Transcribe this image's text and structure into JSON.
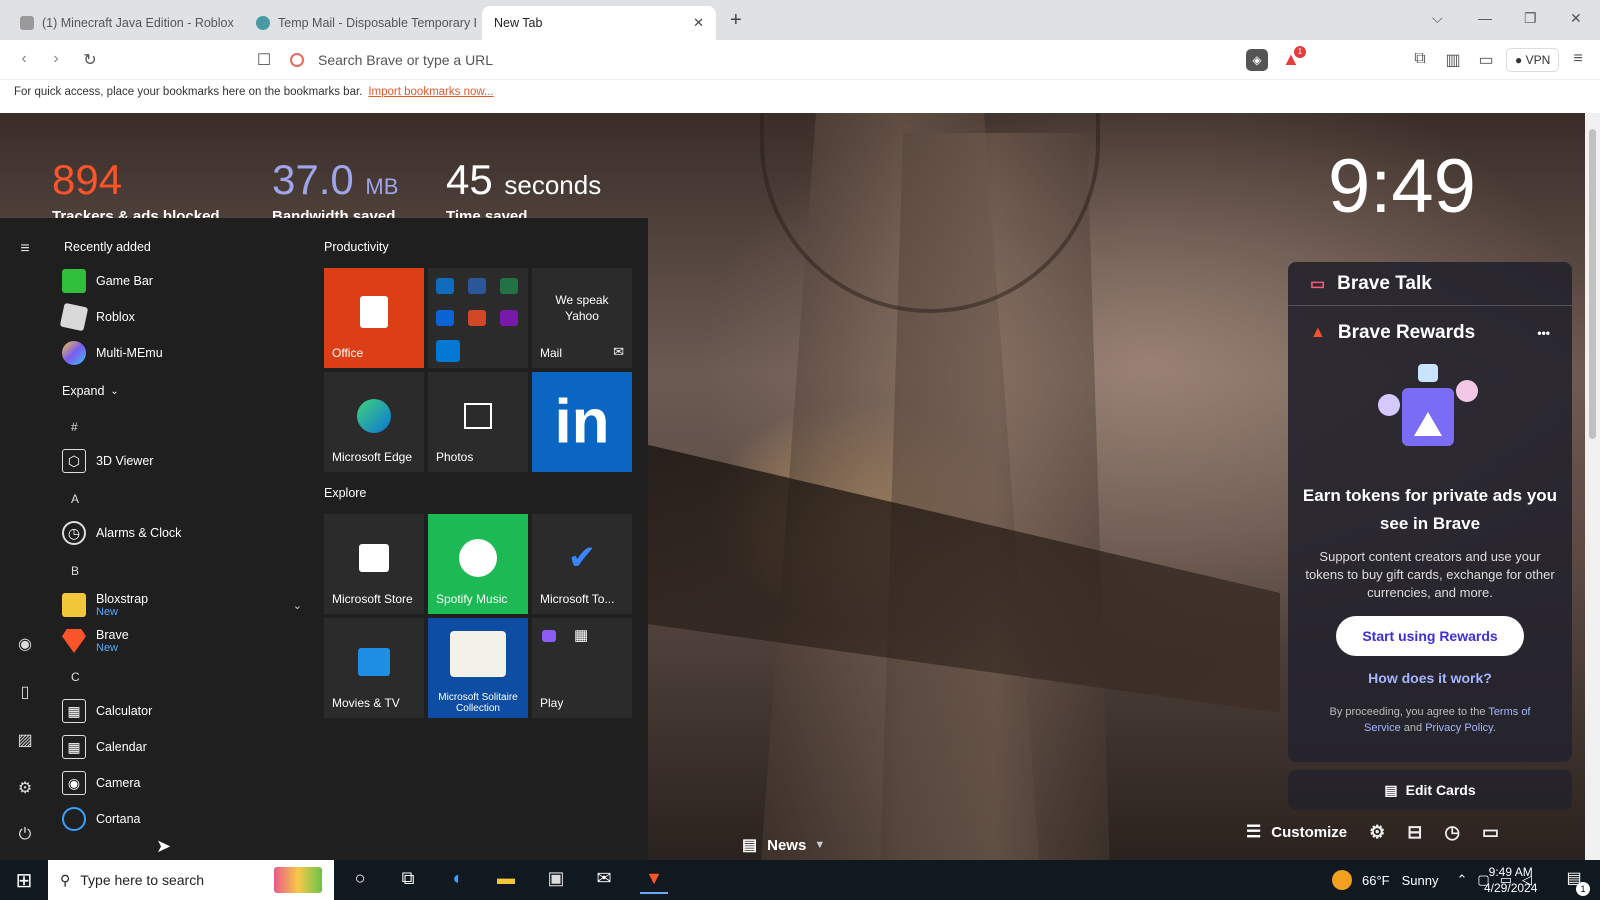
{
  "browser": {
    "tabs": [
      {
        "label": "(1) Minecraft Java Edition - Roblox",
        "favicon_color": "#888888"
      },
      {
        "label": "Temp Mail - Disposable Temporary E",
        "favicon_color": "#4a9aa5"
      },
      {
        "label": "New Tab",
        "favicon_color": ""
      }
    ],
    "new_tab_symbol": "+",
    "tab_close_symbol": "✕",
    "address_placeholder": "Search Brave or type a URL",
    "vpn_label": "VPN",
    "rewards_badge": "1",
    "bookmarks_message": "For quick access, place your bookmarks here on the bookmarks bar.",
    "import_link": "Import bookmarks now..."
  },
  "stats": [
    {
      "value": "894",
      "unit": "",
      "label": "Trackers & ads blocked",
      "color": "#fb542b"
    },
    {
      "value": "37.0",
      "unit": "MB",
      "label": "Bandwidth saved",
      "color": "#a0a5eb"
    },
    {
      "value": "45",
      "unit": "seconds",
      "label": "Time saved",
      "color": "#ffffff"
    }
  ],
  "clock": "9:49",
  "start_menu": {
    "recently_added_label": "Recently added",
    "recent": [
      {
        "name": "Game Bar",
        "icon": "gamebar-icon",
        "color": "#2fbf3a"
      },
      {
        "name": "Roblox",
        "icon": "roblox-icon",
        "color": "#d9d9d9"
      },
      {
        "name": "Multi-MEmu",
        "icon": "memu-icon",
        "color": "#7a5cf0"
      }
    ],
    "expand_label": "Expand",
    "letters": [
      "#",
      "A",
      "B",
      "C"
    ],
    "apps": [
      {
        "name": "3D Viewer",
        "sub": "",
        "icon": "3d-viewer-icon"
      },
      {
        "name": "Alarms & Clock",
        "sub": "",
        "icon": "alarm-clock-icon"
      },
      {
        "name": "Bloxstrap",
        "sub": "New",
        "icon": "folder-icon"
      },
      {
        "name": "Brave",
        "sub": "New",
        "icon": "brave-icon"
      },
      {
        "name": "Calculator",
        "sub": "",
        "icon": "calculator-icon"
      },
      {
        "name": "Calendar",
        "sub": "",
        "icon": "calendar-icon"
      },
      {
        "name": "Camera",
        "sub": "",
        "icon": "camera-icon"
      },
      {
        "name": "Cortana",
        "sub": "",
        "icon": "cortana-icon"
      }
    ],
    "productivity_label": "Productivity",
    "explore_label": "Explore",
    "tiles": {
      "office": "Office",
      "yahoo_text": "We speak Yahoo",
      "mail": "Mail",
      "edge": "Microsoft Edge",
      "photos": "Photos",
      "linkedin": "in",
      "store": "Microsoft Store",
      "spotify": "Spotify Music",
      "todo": "Microsoft To...",
      "movies": "Movies & TV",
      "solitaire": "Microsoft Solitaire Collection",
      "play": "Play"
    }
  },
  "rewards": {
    "talk_title": "Brave Talk",
    "title": "Brave Rewards",
    "more": "•••",
    "headline": "Earn tokens for private ads you see in Brave",
    "description": "Support content creators and use your tokens to buy gift cards, exchange for other currencies, and more.",
    "cta": "Start using Rewards",
    "how": "How does it work?",
    "terms_prefix": "By proceeding, you agree to the",
    "terms_link": "Terms of Service",
    "terms_and": "and",
    "privacy_link": "Privacy Policy",
    "terms_suffix": ".",
    "edit_cards": "Edit Cards"
  },
  "bottom": {
    "customize": "Customize",
    "news": "News"
  },
  "taskbar": {
    "search_placeholder": "Type here to search",
    "weather_temp": "66°F",
    "weather_desc": "Sunny",
    "time": "9:49 AM",
    "date": "4/29/2024",
    "notif_count": "1"
  }
}
